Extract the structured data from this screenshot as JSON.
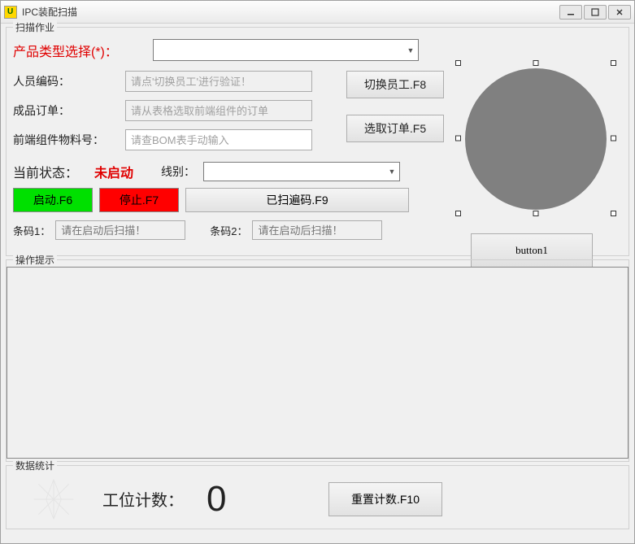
{
  "window": {
    "title": "IPC装配扫描"
  },
  "fieldsets": {
    "scan": "扫描作业",
    "hint": "操作提示",
    "stats": "数据统计"
  },
  "form": {
    "product_type_label": "产品类型选择(*)：",
    "staff_code_label": "人员编码：",
    "staff_code_placeholder": "请点'切换员工'进行验证！",
    "product_order_label": "成品订单：",
    "product_order_placeholder": "请从表格选取前端组件的订单",
    "front_material_label": "前端组件物料号：",
    "front_material_placeholder": "请查BOM表手动输入",
    "switch_staff_btn": "切换员工.F8",
    "select_order_btn": "选取订单.F5",
    "status_label": "当前状态：",
    "status_value": "未启动",
    "line_label": "线别：",
    "start_btn": "启动.F6",
    "stop_btn": "停止.F7",
    "scanned_btn": "已扫遍码.F9",
    "barcode1_label": "条码1：",
    "barcode1_placeholder": "请在启动后扫描！",
    "barcode2_label": "条码2：",
    "barcode2_placeholder": "请在启动后扫描！"
  },
  "right": {
    "button1": "button1"
  },
  "stats": {
    "count_label": "工位计数：",
    "count_value": "0",
    "reset_btn": "重置计数.F10"
  }
}
